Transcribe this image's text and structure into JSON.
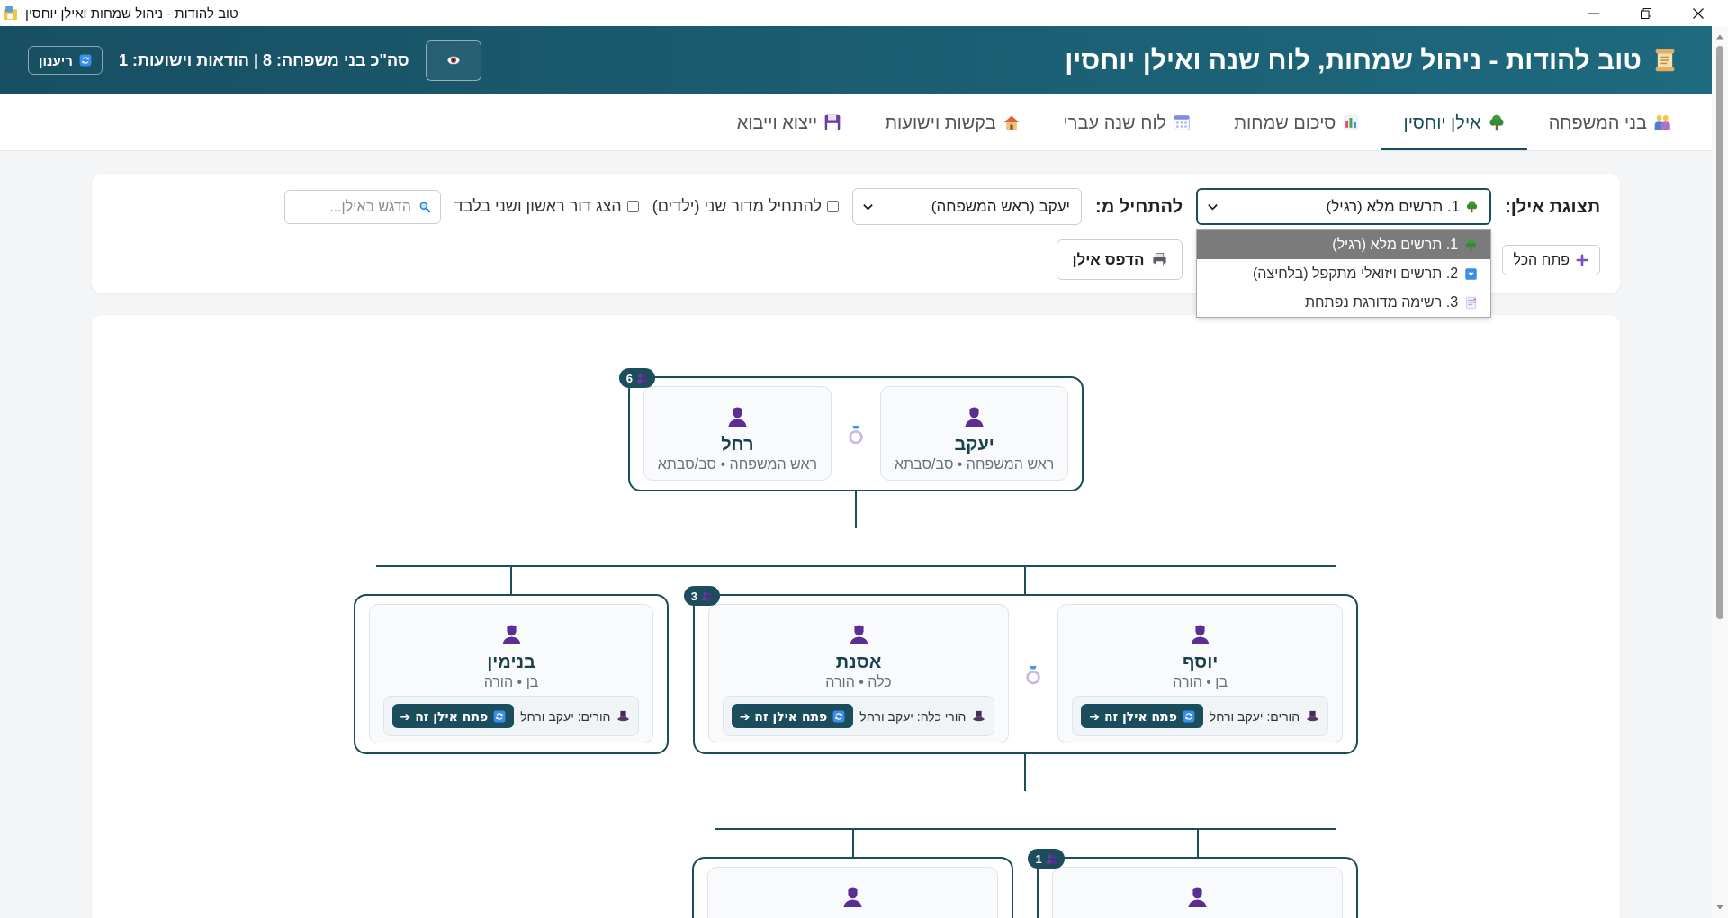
{
  "window": {
    "title": "טוב להודות - ניהול שמחות ואילן יוחסין"
  },
  "header": {
    "title": "טוב להודות - ניהול שמחות, לוח שנה ואילן יוחסין",
    "stats": "סה\"כ בני משפחה: 8 | הודאות וישועות: 1",
    "refresh_button": "ריענון"
  },
  "tabs": [
    {
      "label": "בני המשפחה",
      "selected": false
    },
    {
      "label": "אילן יוחסין",
      "selected": true
    },
    {
      "label": "סיכום שמחות",
      "selected": false
    },
    {
      "label": "לוח שנה עברי",
      "selected": false
    },
    {
      "label": "בקשות וישועות",
      "selected": false
    },
    {
      "label": "ייצוא וייבוא",
      "selected": false
    }
  ],
  "controls": {
    "view_label": "תצוגת אילן:",
    "view_select": {
      "value": "1. תרשים מלא (רגיל)",
      "expanded": true,
      "options": [
        {
          "label": "1. תרשים מלא (רגיל)",
          "selected": true
        },
        {
          "label": "2. תרשים ויזואלי מתקפל (בלחיצה)",
          "selected": false
        },
        {
          "label": "3. רשימה מדורגת נפתחת",
          "selected": false
        }
      ]
    },
    "start_label": "להתחיל מ:",
    "start_select": {
      "value": "יעקב (ראש המשפחה)"
    },
    "checkboxes": [
      {
        "label": "להתחיל מדור שני (ילדים)",
        "checked": false
      },
      {
        "label": "הצג דור ראשון ושני בלבד",
        "checked": false
      }
    ],
    "search": {
      "placeholder": "הדגש באילן..."
    },
    "expand_all_button": "פתח הכל",
    "print_button": "הדפס אילן"
  },
  "tree": {
    "root": {
      "count": "6",
      "members": [
        {
          "kind": "card",
          "name": "יעקב",
          "role": "ראש המשפחה • סב/סבתא"
        },
        {
          "kind": "card",
          "name": "רחל",
          "role": "ראש המשפחה • סב/סבתא"
        }
      ],
      "children": [
        {
          "count": "3",
          "members": [
            {
              "kind": "card",
              "name": "יוסף",
              "role": "בן • הורה",
              "parents": "הורים: יעקב ורחל",
              "open_button": "פתח אילן זה ➔"
            },
            {
              "kind": "card",
              "name": "אסנת",
              "role": "כלה • הורה",
              "parents": "הורי כלה: יעקב ורחל",
              "open_button": "פתח אילן זה ➔"
            }
          ],
          "children": [
            {
              "count": "1",
              "members": [
                {
                  "kind": "clipped"
                }
              ]
            },
            {
              "members": [
                {
                  "kind": "clipped"
                }
              ]
            }
          ]
        },
        {
          "members": [
            {
              "kind": "card",
              "name": "בנימין",
              "role": "בן • הורה",
              "parents": "הורים: יעקב ורחל",
              "open_button": "פתח אילן זה ➔"
            }
          ]
        }
      ]
    }
  }
}
